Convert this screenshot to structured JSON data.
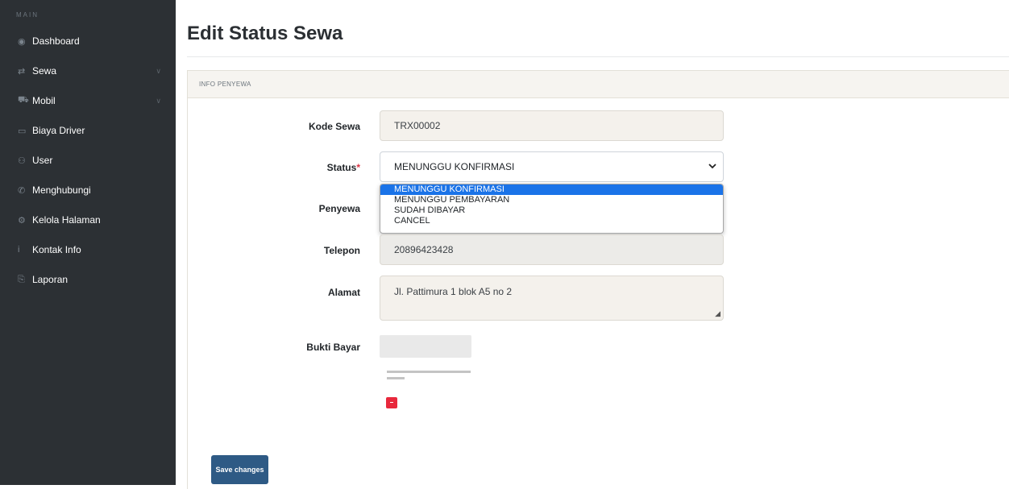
{
  "sidebar": {
    "section_label": "MAIN",
    "items": [
      {
        "label": "Dashboard",
        "icon": "tachometer-icon",
        "glyph": "◉",
        "has_submenu": false
      },
      {
        "label": "Sewa",
        "icon": "exchange-icon",
        "glyph": "⇄",
        "has_submenu": true
      },
      {
        "label": "Mobil",
        "icon": "car-icon",
        "glyph": "⛟",
        "has_submenu": true
      },
      {
        "label": "Biaya Driver",
        "icon": "money-icon",
        "glyph": "▭",
        "has_submenu": false
      },
      {
        "label": "User",
        "icon": "users-icon",
        "glyph": "⚇",
        "has_submenu": false
      },
      {
        "label": "Menghubungi",
        "icon": "phone-icon",
        "glyph": "✆",
        "has_submenu": false
      },
      {
        "label": "Kelola Halaman",
        "icon": "gear-icon",
        "glyph": "⚙",
        "has_submenu": false
      },
      {
        "label": "Kontak Info",
        "icon": "info-icon",
        "glyph": "i",
        "has_submenu": false
      },
      {
        "label": "Laporan",
        "icon": "report-icon",
        "glyph": "⎘",
        "has_submenu": false
      }
    ],
    "chevron_glyph": "∨"
  },
  "page": {
    "title": "Edit Status Sewa"
  },
  "card": {
    "header": "INFO PENYEWA"
  },
  "form": {
    "kode_sewa": {
      "label": "Kode Sewa",
      "value": "TRX00002"
    },
    "status": {
      "label": "Status",
      "required_mark": "*",
      "selected": "MENUNGGU KONFIRMASI",
      "options": [
        "MENUNGGU KONFIRMASI",
        "MENUNGGU PEMBAYARAN",
        "SUDAH DIBAYAR",
        "CANCEL"
      ]
    },
    "penyewa": {
      "label": "Penyewa"
    },
    "telepon": {
      "label": "Telepon",
      "value": "20896423428"
    },
    "alamat": {
      "label": "Alamat",
      "value": "Jl. Pattimura 1 blok A5 no 2"
    },
    "bukti_bayar": {
      "label": "Bukti Bayar"
    }
  },
  "actions": {
    "save_label": "Save changes"
  },
  "colors": {
    "sidebar_bg": "#2c3034",
    "primary_button": "#2e5a85",
    "required": "#dc3545",
    "dropdown_highlight": "#1a73e8",
    "delete_button": "#e8283c"
  }
}
